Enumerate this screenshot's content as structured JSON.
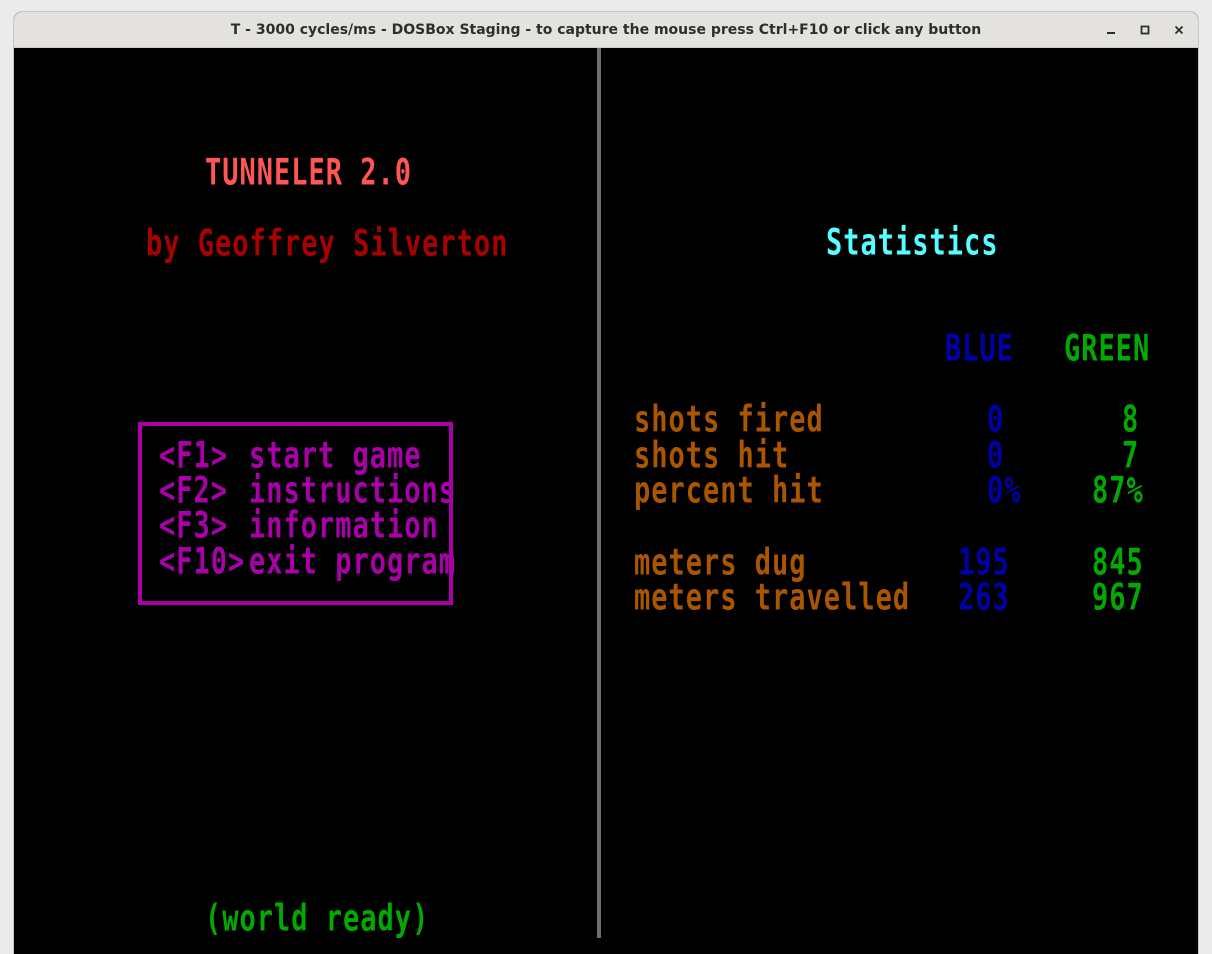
{
  "window": {
    "title": "T - 3000 cycles/ms - DOSBox Staging - to capture the mouse press Ctrl+F10 or click any button",
    "controls": {
      "minimize_icon": "minimize-icon",
      "maximize_icon": "maximize-icon",
      "close_icon": "close-icon"
    }
  },
  "game": {
    "title": "TUNNELER 2.0",
    "author": "by Geoffrey Silverton",
    "menu": [
      {
        "key": "<F1>",
        "label": "start game"
      },
      {
        "key": "<F2>",
        "label": "instructions"
      },
      {
        "key": "<F3>",
        "label": "information"
      },
      {
        "key": "<F10>",
        "label": "exit program"
      }
    ],
    "status": "(world ready)"
  },
  "stats": {
    "heading": "Statistics",
    "columns": [
      "BLUE",
      "GREEN"
    ],
    "rows": [
      {
        "label": "shots fired",
        "blue": "0",
        "green": "8"
      },
      {
        "label": "shots hit",
        "blue": "0",
        "green": "7"
      },
      {
        "label": "percent hit",
        "blue": "0%",
        "green": "87%"
      },
      {
        "label": "meters dug",
        "blue": "195",
        "green": "845"
      },
      {
        "label": "meters travelled",
        "blue": "263",
        "green": "967"
      }
    ]
  },
  "colors": {
    "title": "#ff5555",
    "author": "#aa0000",
    "heading": "#55ffff",
    "menu": "#aa00aa",
    "blue": "#0000aa",
    "green": "#00aa00",
    "labels": "#aa5500",
    "divider": "#6d6d6d"
  }
}
